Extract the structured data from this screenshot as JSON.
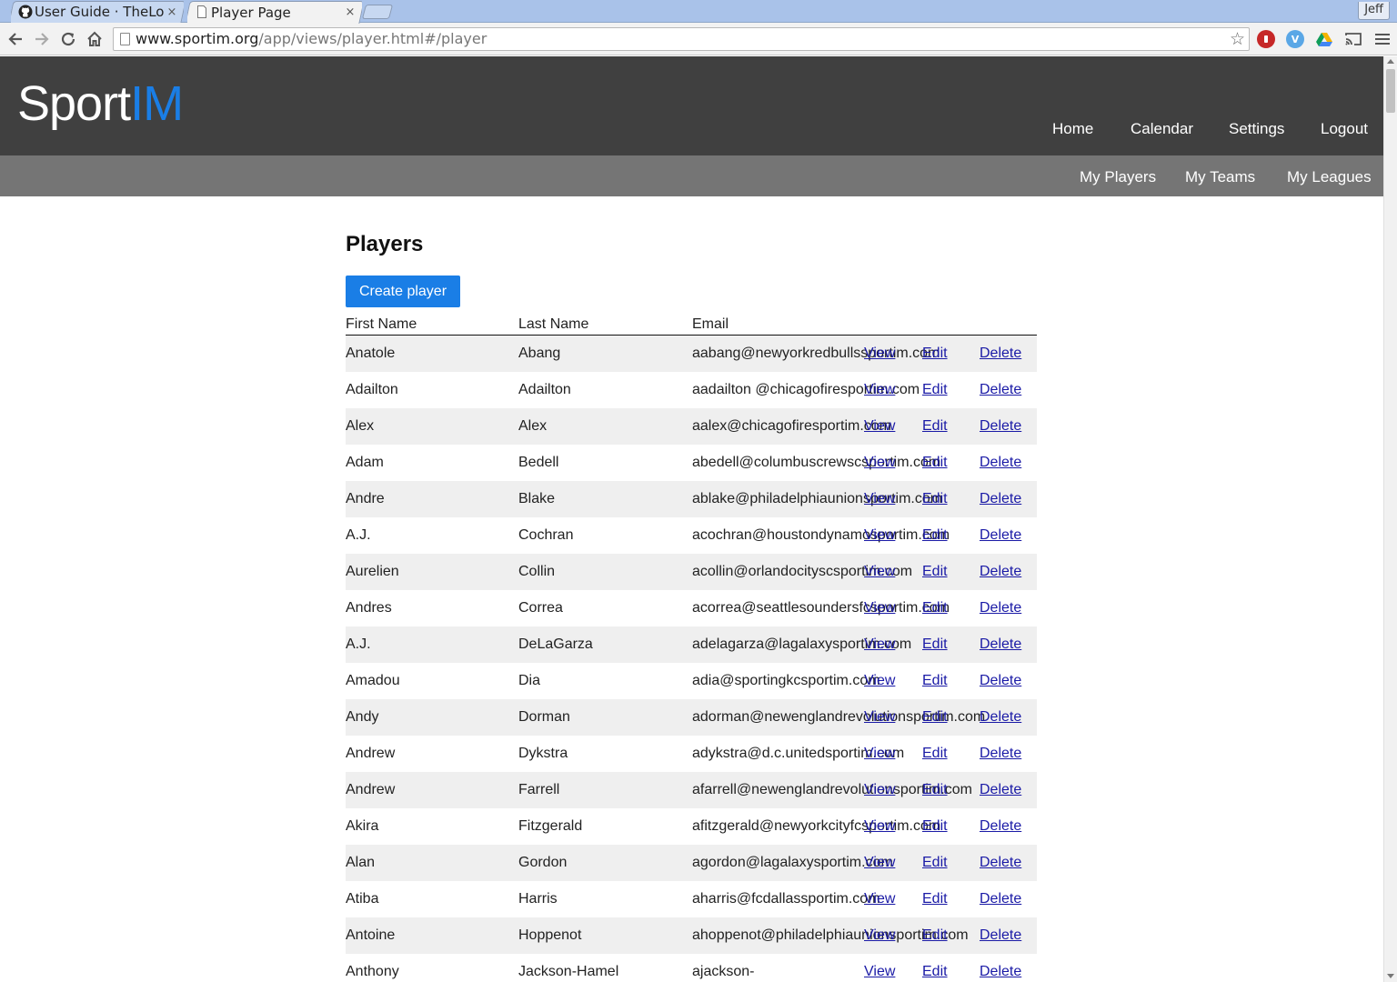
{
  "browser": {
    "tabs": [
      {
        "title": "User Guide · TheLo",
        "favicon": "github-icon",
        "close": "×"
      },
      {
        "title": "Player Page",
        "favicon": "page-icon",
        "close": "×"
      }
    ],
    "profile": "Jeff",
    "url_host": "www.sportim.org",
    "url_path": "/app/views/player.html#/player",
    "toolbar_icons": [
      "back-icon",
      "forward-icon",
      "reload-icon",
      "home-icon",
      "star-icon",
      "menu-icon"
    ]
  },
  "site": {
    "logo_part1": "Sport",
    "logo_part2": "IM",
    "logo_accent_color": "#1a7ee6",
    "nav": [
      "Home",
      "Calendar",
      "Settings",
      "Logout"
    ],
    "subnav": [
      "My Players",
      "My Teams",
      "My Leagues"
    ]
  },
  "main": {
    "title": "Players",
    "create_button": "Create player",
    "columns": [
      "First Name",
      "Last Name",
      "Email"
    ],
    "actions": {
      "view": "View",
      "edit": "Edit",
      "delete": "Delete"
    },
    "rows": [
      {
        "first": "Anatole",
        "last": "Abang",
        "email": "aabang@newyorkredbullssportim.com"
      },
      {
        "first": "Adailton",
        "last": "Adailton",
        "email": "aadailton    @chicagofiresportim.com"
      },
      {
        "first": "Alex",
        "last": "Alex",
        "email": "aalex@chicagofiresportim.com"
      },
      {
        "first": "Adam",
        "last": "Bedell",
        "email": "abedell@columbuscrewscsportim.com"
      },
      {
        "first": "Andre",
        "last": "Blake",
        "email": "ablake@philadelphiaunionsportim.com"
      },
      {
        "first": "A.J.",
        "last": "Cochran",
        "email": "acochran@houstondynamosportim.com"
      },
      {
        "first": "Aurelien",
        "last": "Collin",
        "email": "acollin@orlandocityscsportim.com"
      },
      {
        "first": "Andres",
        "last": "Correa",
        "email": "acorrea@seattlesoundersfcsportim.com"
      },
      {
        "first": "A.J.",
        "last": "DeLaGarza",
        "email": "adelagarza@lagalaxysportim.com"
      },
      {
        "first": "Amadou",
        "last": "Dia",
        "email": "adia@sportingkcsportim.com"
      },
      {
        "first": "Andy",
        "last": "Dorman",
        "email": "adorman@newenglandrevolutionsportim.com"
      },
      {
        "first": "Andrew",
        "last": "Dykstra",
        "email": "adykstra@d.c.unitedsportim.com"
      },
      {
        "first": "Andrew",
        "last": "Farrell",
        "email": "afarrell@newenglandrevolutionsportim.com"
      },
      {
        "first": "Akira",
        "last": "Fitzgerald",
        "email": "afitzgerald@newyorkcityfcsportim.com"
      },
      {
        "first": "Alan",
        "last": "Gordon",
        "email": "agordon@lagalaxysportim.com"
      },
      {
        "first": "Atiba",
        "last": "Harris",
        "email": "aharris@fcdallassportim.com"
      },
      {
        "first": "Antoine",
        "last": "Hoppenot",
        "email": "ahoppenot@philadelphiaunionsportim.com"
      },
      {
        "first": "Anthony",
        "last": "Jackson-Hamel",
        "email": "ajackson-"
      }
    ]
  }
}
